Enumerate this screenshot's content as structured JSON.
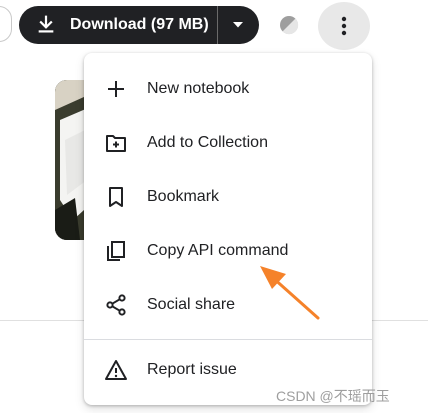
{
  "toolbar": {
    "download_label": "Download (97 MB)",
    "download_icon": "download-icon",
    "caret_icon": "chevron-down-icon",
    "contrast_icon": "contrast-icon",
    "more_icon": "more-vert-icon"
  },
  "menu": {
    "items": [
      {
        "label": "New notebook",
        "icon": "plus-icon"
      },
      {
        "label": "Add to Collection",
        "icon": "folder-add-icon"
      },
      {
        "label": "Bookmark",
        "icon": "bookmark-icon"
      },
      {
        "label": "Copy API command",
        "icon": "copy-icon"
      },
      {
        "label": "Social share",
        "icon": "share-icon"
      },
      {
        "label": "Report issue",
        "icon": "warning-icon"
      }
    ]
  },
  "annotation": {
    "arrow_color": "#f5822a"
  },
  "watermark": "CSDN @不瑶而玉",
  "colors": {
    "button_bg": "#202124",
    "menu_text": "#202124",
    "icon": "#202124"
  }
}
